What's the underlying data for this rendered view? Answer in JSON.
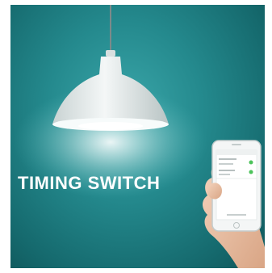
{
  "banner": {
    "title": "TIMING SWITCH"
  },
  "colors": {
    "wall": "#24898d",
    "lamp_shade": "#e9eeee",
    "text": "#ffffff"
  }
}
